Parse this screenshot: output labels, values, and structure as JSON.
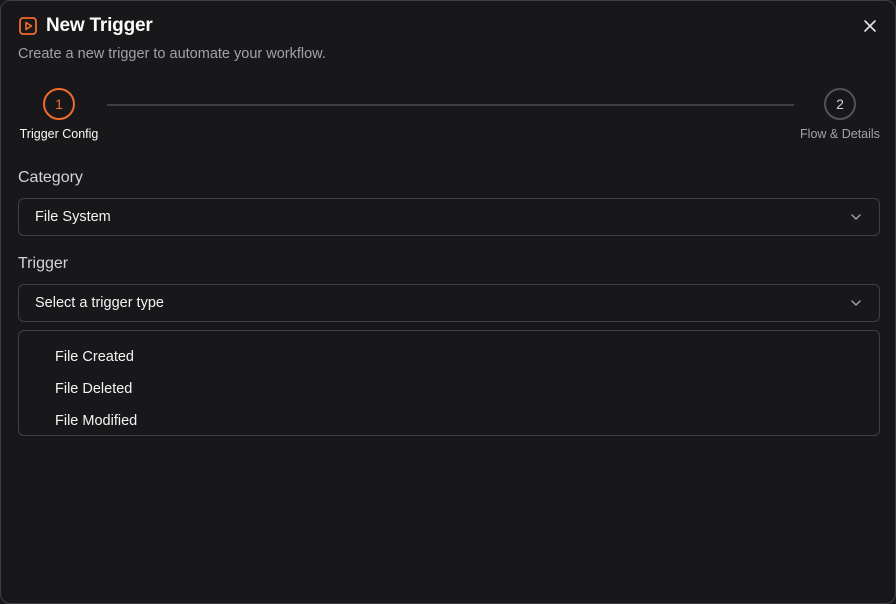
{
  "dialog": {
    "title": "New Trigger",
    "title_icon": "play-square-icon",
    "subtitle": "Create a new trigger to automate your workflow.",
    "close_icon": "close-icon",
    "accent_color": "#f26b2a"
  },
  "stepper": {
    "steps": [
      {
        "number": "1",
        "label": "Trigger Config",
        "state": "active"
      },
      {
        "number": "2",
        "label": "Flow & Details",
        "state": "inactive"
      }
    ]
  },
  "category": {
    "label": "Category",
    "value": "File System",
    "icon": "chevron-down-icon"
  },
  "trigger": {
    "label": "Trigger",
    "placeholder": "Select a trigger type",
    "icon": "chevron-down-icon",
    "options": [
      "File Created",
      "File Deleted",
      "File Modified"
    ]
  }
}
